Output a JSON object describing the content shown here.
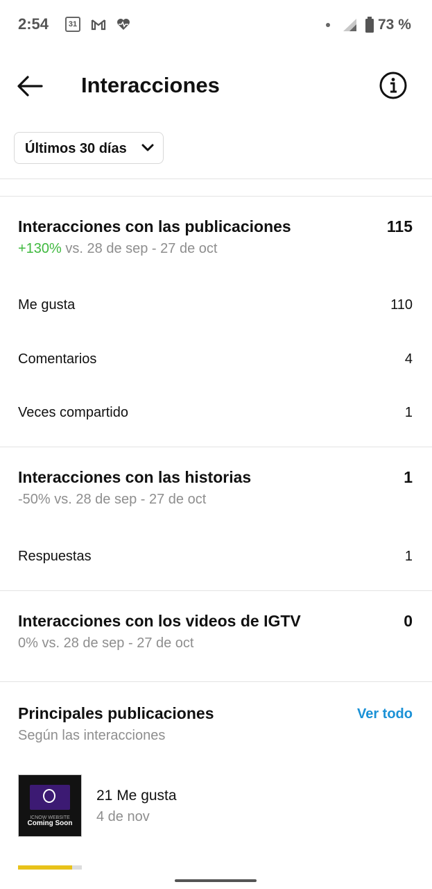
{
  "status_bar": {
    "time": "2:54",
    "calendar_day": "31",
    "battery": "73 %"
  },
  "header": {
    "title": "Interacciones"
  },
  "filter": {
    "range_label": "Últimos 30 días"
  },
  "sections": {
    "posts": {
      "title": "Interacciones con las publicaciones",
      "value": "115",
      "change": "+130%",
      "compare": " vs. 28 de sep - 27 de oct",
      "items": [
        {
          "label": "Me gusta",
          "value": "110"
        },
        {
          "label": "Comentarios",
          "value": "4"
        },
        {
          "label": "Veces compartido",
          "value": "1"
        }
      ]
    },
    "stories": {
      "title": "Interacciones con las historias",
      "value": "1",
      "change": "-50%",
      "compare": " vs. 28 de sep - 27 de oct",
      "items": [
        {
          "label": "Respuestas",
          "value": "1"
        }
      ]
    },
    "igtv": {
      "title": "Interacciones con los videos de IGTV",
      "value": "0",
      "change": "0%",
      "compare": " vs. 28 de sep - 27 de oct"
    }
  },
  "top_posts": {
    "title": "Principales publicaciones",
    "subtitle": "Según las interacciones",
    "see_all": "Ver todo",
    "posts": [
      {
        "likes": "21 Me gusta",
        "date": "4 de nov",
        "thumb_text": "Coming Soon",
        "thumb_small": "ICNOW WEBSITE"
      }
    ]
  },
  "colors": {
    "positive": "#3fb93f",
    "link": "#1a91d6",
    "muted": "#8e8e8e"
  }
}
